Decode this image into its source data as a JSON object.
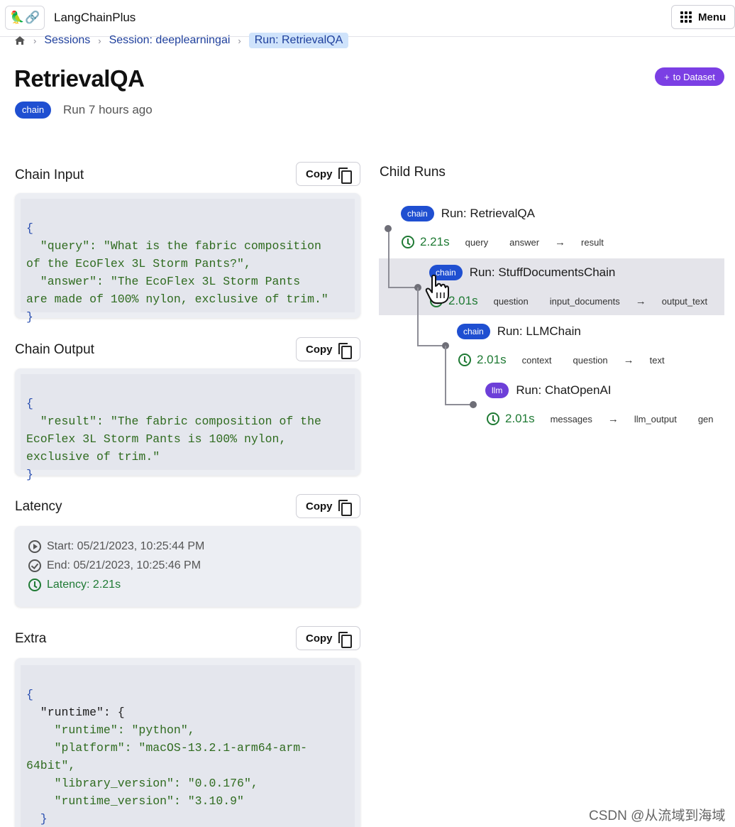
{
  "topbar": {
    "logo_glyph": "🦜🔗",
    "app_title": "LangChainPlus",
    "menu_label": "Menu"
  },
  "breadcrumb": {
    "items": [
      "Sessions",
      "Session: deeplearningai",
      "Run: RetrievalQA"
    ]
  },
  "header": {
    "title": "RetrievalQA",
    "type_badge": "chain",
    "run_time": "Run 7 hours ago",
    "to_dataset_label": "to Dataset"
  },
  "chain_input": {
    "title": "Chain Input",
    "copy_label": "Copy",
    "lines": [
      "{",
      "  \"query\": \"What is the fabric composition",
      "of the EcoFlex 3L Storm Pants?\",",
      "  \"answer\": \"The EcoFlex 3L Storm Pants",
      "are made of 100% nylon, exclusive of trim.\"",
      "}"
    ]
  },
  "chain_output": {
    "title": "Chain Output",
    "copy_label": "Copy",
    "lines": [
      "{",
      "  \"result\": \"The fabric composition of the",
      "EcoFlex 3L Storm Pants is 100% nylon,",
      "exclusive of trim.\"",
      "}"
    ]
  },
  "latency": {
    "title": "Latency",
    "copy_label": "Copy",
    "start": "Start: 05/21/2023, 10:25:44 PM",
    "end": "End: 05/21/2023, 10:25:46 PM",
    "latency": "Latency: 2.21s"
  },
  "extra": {
    "title": "Extra",
    "copy_label": "Copy",
    "lines": [
      "{",
      "  \"runtime\": {",
      "    \"runtime\": \"python\",",
      "    \"platform\": \"macOS-13.2.1-arm64-arm-",
      "64bit\",",
      "    \"library_version\": \"0.0.176\",",
      "    \"runtime_version\": \"3.10.9\"",
      "  }",
      "}"
    ]
  },
  "child_runs": {
    "title": "Child Runs",
    "runs": [
      {
        "badge": "chain",
        "name": "Run: RetrievalQA",
        "latency": "2.21s",
        "inputs": [
          "query",
          "answer"
        ],
        "outputs": [
          "result"
        ]
      },
      {
        "badge": "chain",
        "name": "Run: StuffDocumentsChain",
        "latency": "2.01s",
        "inputs": [
          "question",
          "input_documents"
        ],
        "outputs": [
          "output_text"
        ]
      },
      {
        "badge": "chain",
        "name": "Run: LLMChain",
        "latency": "2.01s",
        "inputs": [
          "context",
          "question"
        ],
        "outputs": [
          "text"
        ]
      },
      {
        "badge": "llm",
        "name": "Run: ChatOpenAI",
        "latency": "2.01s",
        "inputs": [
          "messages"
        ],
        "outputs": [
          "llm_output",
          "gen"
        ]
      }
    ],
    "arrow": "→"
  },
  "watermark": "CSDN @从流域到海域",
  "colors": {
    "chain_badge": "#1f4fd1",
    "llm_badge": "#6d3fd8",
    "to_dataset": "#7b3fe4",
    "latency_green": "#1f7a34",
    "breadcrumb_link": "#1e3f9c"
  }
}
